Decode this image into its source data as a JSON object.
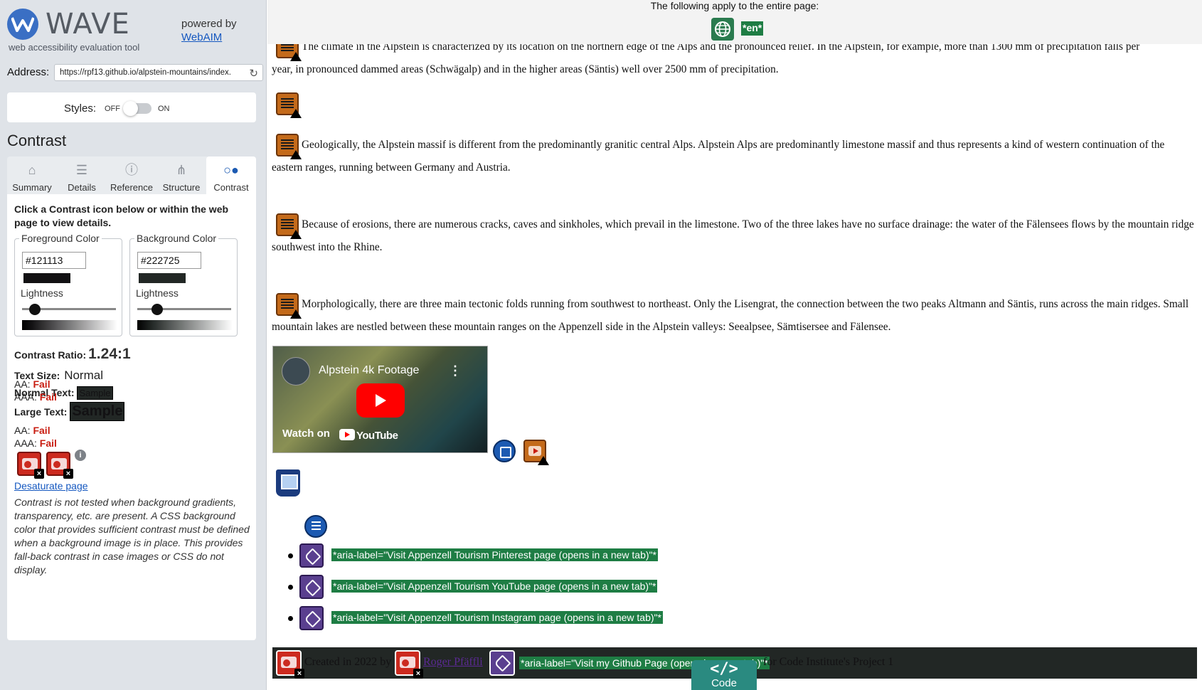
{
  "sidebar": {
    "logo_text": "WAVE",
    "logo_sub": "web accessibility evaluation tool",
    "powered_by": "powered by",
    "webaim_link": "WebAIM",
    "address_label": "Address:",
    "address_value": "https://rpf13.github.io/alpstein-mountains/index.",
    "styles_label": "Styles:",
    "styles_off": "OFF",
    "styles_on": "ON",
    "panel_title": "Contrast",
    "tabs": [
      {
        "label": "Summary",
        "icon": "home-icon"
      },
      {
        "label": "Details",
        "icon": "list-icon"
      },
      {
        "label": "Reference",
        "icon": "info-icon"
      },
      {
        "label": "Structure",
        "icon": "hierarchy-icon"
      },
      {
        "label": "Contrast",
        "icon": "contrast-icon"
      }
    ],
    "active_tab": "Contrast",
    "instructions": "Click a Contrast icon below or within the web page to view details.",
    "foreground": {
      "legend": "Foreground Color",
      "value": "#121113",
      "lightness_label": "Lightness",
      "lightness": 0.1
    },
    "background": {
      "legend": "Background Color",
      "value": "#222725",
      "lightness_label": "Lightness",
      "lightness": 0.2
    },
    "ratio_label": "Contrast Ratio:",
    "ratio_value": "1.24:1",
    "text_size_label": "Text Size:",
    "text_size_value": "Normal",
    "normal_text_label": "Normal Text:",
    "large_text_label": "Large Text:",
    "sample": "Sample",
    "aa_label": "AA:",
    "aaa_label": "AAA:",
    "fail": "Fail",
    "desaturate_link": "Desaturate page",
    "note": "Contrast is not tested when background gradients, transparency, etc. are present. A CSS background color that provides sufficient contrast must be defined when a background image is in place. This provides fall-back contrast in case images or CSS do not display.",
    "colors": {
      "fail": "#c81d11",
      "link": "#1558c0",
      "sidebar_bg": "#dfe3e8"
    }
  },
  "main": {
    "banner_text": "The following apply to the entire page:",
    "lang_tag": "*en*",
    "para0_line1": "The climate in the Alpstein is characterized by its location on the northern edge of the Alps and the pronounced relief. In the Alpstein, for example, more than 1300 mm of precipitation falls per",
    "para0_line2": "year, in pronounced dammed areas (Schwägalp) and in the higher areas (Säntis) well over 2500 mm of precipitation.",
    "para1": "Geologically, the Alpstein massif is different from the predominantly granitic central Alps. Alpstein Alps are predominantly limestone massif and thus represents a kind of western continuation of the eastern ranges, running between Germany and Austria.",
    "para2": "Because of erosions, there are numerous cracks, caves and sinkholes, which prevail in the limestone. Two of the three lakes have no surface drainage: the water of the Fälensees flows by the mountain ridge southwest into the Rhine.",
    "para3": "Morphologically, there are three main tectonic folds running from southwest to northeast. Only the Lisengrat, the connection between the two peaks Altmann and Säntis, runs across the main ridges. Small mountain lakes are nestled between these mountain ranges on the Appenzell side in the Alpstein valleys: Seealpsee, Sämtisersee and Fälensee.",
    "video": {
      "title": "Alpstein 4k Footage",
      "watch_on": "Watch on",
      "youtube": "YouTube"
    },
    "social": [
      {
        "aria": "*aria-label=\"Visit Appenzell Tourism Pinterest page (opens in a new tab)\"*"
      },
      {
        "aria": "*aria-label=\"Visit Appenzell Tourism YouTube page (opens in a new tab)\"*"
      },
      {
        "aria": "*aria-label=\"Visit Appenzell Tourism Instagram page (opens in a new tab)\"*"
      }
    ],
    "footer": {
      "created": "Created in 2022 by",
      "author": "Roger Pfäffli",
      "github_aria": "*aria-label=\"Visit my Github Page (opens in a new tab)\"*",
      "suffix": "for Code Institute's Project 1"
    },
    "code_tab": {
      "symbol": "</>",
      "label": "Code"
    },
    "colors": {
      "aria_bg": "#1e7d44",
      "footer_bg": "#222725",
      "footer_fg": "#121113",
      "warning": "#c46a1a"
    }
  }
}
